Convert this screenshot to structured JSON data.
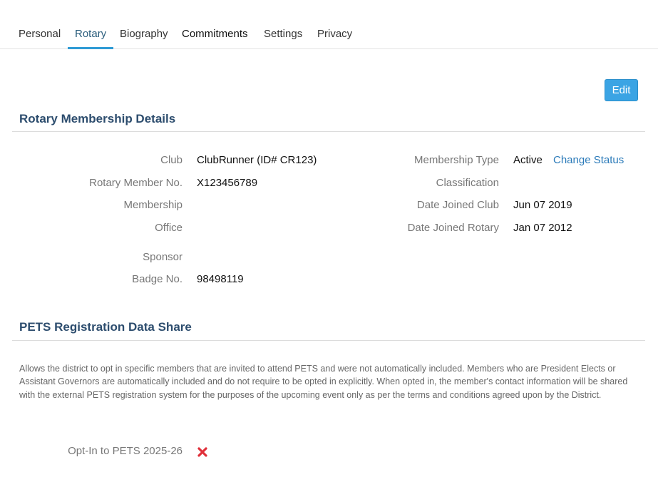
{
  "tabs": [
    {
      "label": "Personal"
    },
    {
      "label": "Rotary"
    },
    {
      "label": "Biography"
    },
    {
      "label": "Commitments"
    },
    {
      "label": "Settings"
    },
    {
      "label": "Privacy"
    }
  ],
  "active_tab": "Rotary",
  "edit_button": {
    "label": "Edit"
  },
  "membership_section": {
    "title": "Rotary Membership Details",
    "club": {
      "label": "Club",
      "value": "ClubRunner (ID# CR123)"
    },
    "member_no": {
      "label": "Rotary Member No.",
      "value": "X123456789"
    },
    "membership": {
      "label": "Membership",
      "value": ""
    },
    "office": {
      "label": "Office",
      "value": ""
    },
    "sponsor": {
      "label": "Sponsor",
      "value": ""
    },
    "badge_no": {
      "label": "Badge No.",
      "value": "98498119"
    },
    "membership_type": {
      "label": "Membership Type",
      "value": "Active",
      "action": "Change Status"
    },
    "classification": {
      "label": "Classification",
      "value": ""
    },
    "date_joined_club": {
      "label": "Date Joined Club",
      "value": "Jun 07 2019"
    },
    "date_joined_rotary": {
      "label": "Date Joined Rotary",
      "value": "Jan 07 2012"
    }
  },
  "pets_section": {
    "title": "PETS Registration Data Share",
    "description": "Allows the district to opt in specific members that are invited to attend PETS and were not automatically included. Members who are President Elects or Assistant Governors are automatically included and do not require to be opted in explicitly. When opted in, the member's contact information will be shared with the external PETS registration system for the purposes of the upcoming event only as per the terms and conditions agreed upon by the District.",
    "opt_in": {
      "label": "Opt-In to PETS 2025-26",
      "icon": "x-mark-icon",
      "icon_color": "#e0303a"
    }
  },
  "colors": {
    "accent": "#2f9bd5",
    "button": "#3ba4e4",
    "section_title": "#2d4d6e",
    "link": "#2a7ab9"
  }
}
